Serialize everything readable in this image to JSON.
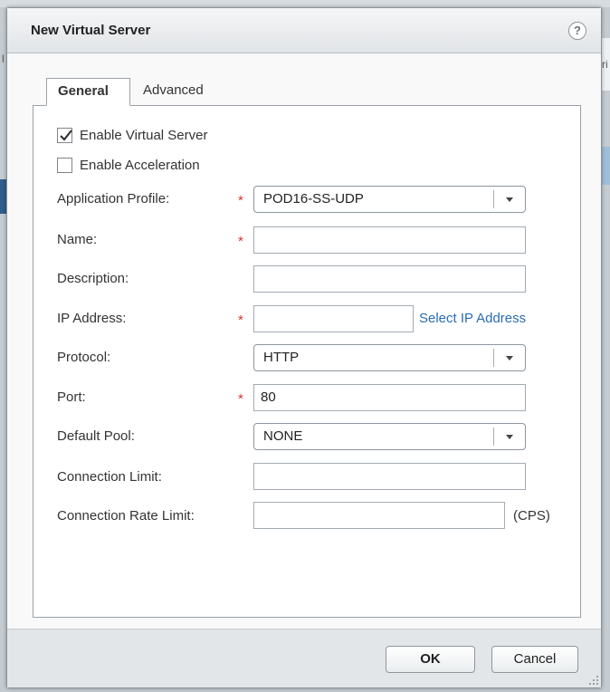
{
  "dialog": {
    "title": "New Virtual Server",
    "help_glyph": "?"
  },
  "background": {
    "right_fragment": "ri",
    "left_fragment": "l"
  },
  "tabs": [
    {
      "label": "General",
      "active": true
    },
    {
      "label": "Advanced",
      "active": false
    }
  ],
  "form": {
    "enable_virtual_server": {
      "label": "Enable Virtual Server",
      "checked": true
    },
    "enable_acceleration": {
      "label": "Enable Acceleration",
      "checked": false
    },
    "required_marker": "*",
    "application_profile": {
      "label": "Application Profile:",
      "value": "POD16-SS-UDP",
      "required": true
    },
    "name": {
      "label": "Name:",
      "value": "",
      "required": true
    },
    "description": {
      "label": "Description:",
      "value": ""
    },
    "ip_address": {
      "label": "IP Address:",
      "value": "",
      "required": true,
      "link": "Select IP Address"
    },
    "protocol": {
      "label": "Protocol:",
      "value": "HTTP"
    },
    "port": {
      "label": "Port:",
      "value": "80",
      "required": true
    },
    "default_pool": {
      "label": "Default Pool:",
      "value": "NONE"
    },
    "connection_limit": {
      "label": "Connection Limit:",
      "value": ""
    },
    "connection_rate_limit": {
      "label": "Connection Rate Limit:",
      "value": "",
      "unit": "(CPS)"
    }
  },
  "buttons": {
    "ok": "OK",
    "cancel": "Cancel"
  },
  "colors": {
    "required": "#d9322c",
    "link": "#2a6db2"
  }
}
